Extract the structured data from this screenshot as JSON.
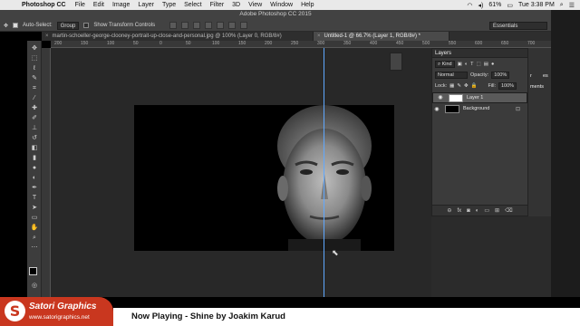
{
  "menubar": {
    "app": "Photoshop CC",
    "items": [
      "File",
      "Edit",
      "Image",
      "Layer",
      "Type",
      "Select",
      "Filter",
      "3D",
      "View",
      "Window",
      "Help"
    ],
    "battery": "61%",
    "clock": "Tue 3:38 PM"
  },
  "window_title": "Adobe Photoshop CC 2015",
  "options": {
    "auto_select_label": "Auto-Select:",
    "auto_select_value": "Group",
    "transform_label": "Show Transform Controls",
    "workspace": "Essentials"
  },
  "tabs": [
    {
      "label": "martin-schoeller-george-clooney-portrait-up-close-and-personal.jpg @ 100% (Layer 0, RGB/8#)",
      "close": "×"
    },
    {
      "label": "Untitled-1 @ 66.7% (Layer 1, RGB/8#) *",
      "close": "×"
    }
  ],
  "ruler": {
    "top": [
      "200",
      "150",
      "100",
      "50",
      "0",
      "50",
      "100",
      "150",
      "200",
      "250",
      "300",
      "350",
      "400",
      "450",
      "500",
      "550",
      "600",
      "650",
      "700"
    ]
  },
  "layers_panel": {
    "title": "Layers",
    "filter": "Kind",
    "blend": "Normal",
    "opacity_label": "Opacity:",
    "opacity_value": "100%",
    "lock_label": "Lock:",
    "fill_label": "Fill:",
    "fill_value": "100%",
    "layers": [
      {
        "name": "Layer 1",
        "selected": true
      },
      {
        "name": "Background",
        "selected": false
      }
    ]
  },
  "side_tabs": {
    "first": "r",
    "second": "es",
    "third": "ments"
  },
  "branding": {
    "name": "Satori Graphics",
    "url": "www.satorigraphics.net",
    "logo_letter": "S"
  },
  "now_playing": "Now Playing - Shine by Joakim Karud",
  "colors": {
    "accent": "#c9371f",
    "guide": "#5fa8ff"
  }
}
